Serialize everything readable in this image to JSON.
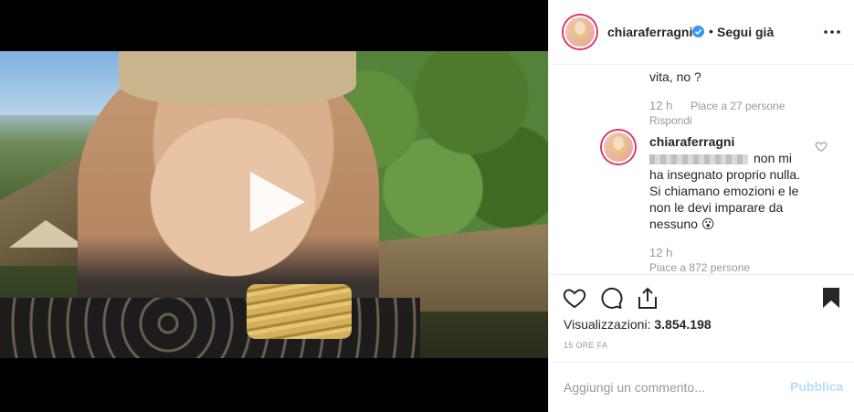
{
  "colors": {
    "accent": "#0095f6",
    "publish_disabled": "#b2dffc",
    "muted": "#999999",
    "text": "#262626"
  },
  "media": {
    "type": "video",
    "play_icon": "play-icon"
  },
  "header": {
    "username": "chiaraferragni",
    "verified_icon": "verified-badge-icon",
    "separator": "•",
    "follow_status": "Segui già",
    "more_icon": "more-options-icon"
  },
  "comments": [
    {
      "text_tail": "vita, no ?",
      "time": "12 h",
      "likes": "Piace a 27 persone",
      "reply": "Rispondi"
    },
    {
      "username": "chiaraferragni",
      "text_line1": "non mi",
      "text_rest": [
        "ha insegnato proprio nulla.",
        "Si chiamano emozioni e le",
        "non le devi imparare da",
        "nessuno 😮"
      ],
      "time": "12 h",
      "likes": "Piace a 872 persone",
      "heart_icon": "heart-outline-icon"
    }
  ],
  "actions": {
    "like_icon": "heart-outline-icon",
    "comment_icon": "comment-icon",
    "share_icon": "share-icon",
    "save_icon": "bookmark-filled-icon",
    "views_label": "Visualizzazioni:",
    "views_count": "3.854.198",
    "time_ago": "15 ORE FA"
  },
  "comment_box": {
    "placeholder": "Aggiungi un commento...",
    "publish": "Pubblica"
  }
}
